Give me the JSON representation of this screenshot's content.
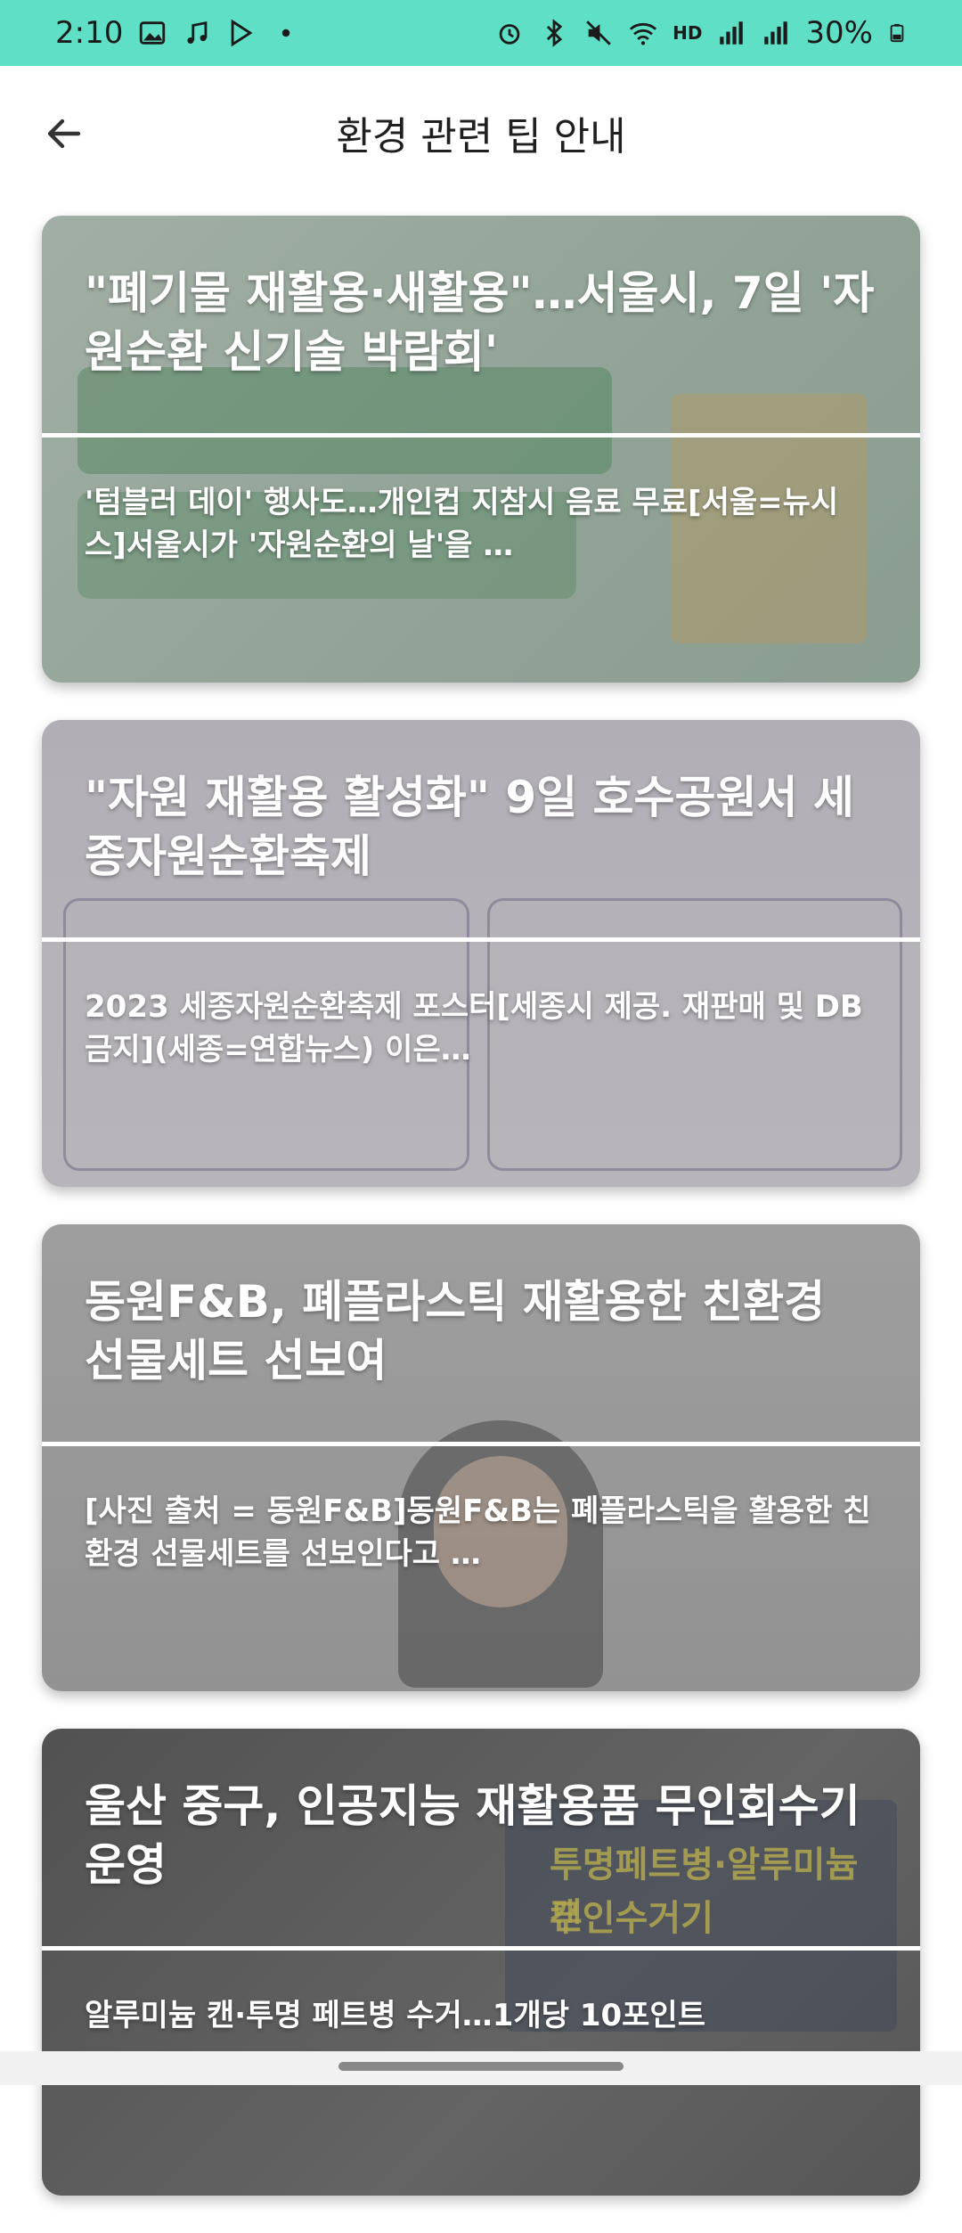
{
  "status": {
    "time": "2:10",
    "battery": "30%",
    "hd_label": "HD"
  },
  "header": {
    "title": "환경 관련 팁 안내"
  },
  "articles": [
    {
      "headline": "\"폐기물 재활용·새활용\"…서울시, 7일 '자원순환 신기술 박람회'",
      "summary": "'텀블러 데이' 행사도…개인컵 지참시 음료 무료[서울=뉴시스]서울시가 '자원순환의 날'을 …"
    },
    {
      "headline": "\"자원 재활용 활성화\" 9일 호수공원서 세종자원순환축제",
      "summary": "2023 세종자원순환축제 포스터[세종시 제공. 재판매 및 DB 금지](세종=연합뉴스) 이은…"
    },
    {
      "headline": "동원F&B, 폐플라스틱 재활용한 친환경 선물세트 선보여",
      "summary": " [사진 출처 = 동원F&B]동원F&B는 폐플라스틱을 활용한 친환경 선물세트를 선보인다고 …"
    },
    {
      "headline": "울산 중구, 인공지능 재활용품 무인회수기 운영",
      "summary": "알루미늄 캔·투명 페트병 수거…1개당 10포인트"
    }
  ],
  "poster_text": {
    "line1": "투명페트병·알루미늄 캔",
    "line2": "무인수거기"
  }
}
